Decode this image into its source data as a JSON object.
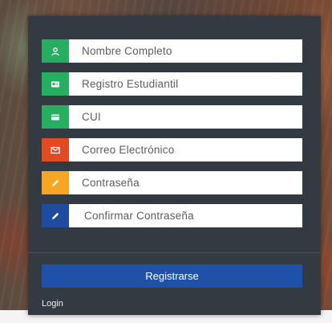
{
  "form": {
    "fields": [
      {
        "placeholder": "Nombre Completo",
        "icon": "user-icon",
        "color": "#27ae60"
      },
      {
        "placeholder": "Registro Estudiantil",
        "icon": "id-card-icon",
        "color": "#27ae60"
      },
      {
        "placeholder": "CUI",
        "icon": "card-icon",
        "color": "#27ae60"
      },
      {
        "placeholder": "Correo Electrónico",
        "icon": "envelope-icon",
        "color": "#e04b24"
      },
      {
        "placeholder": "Contraseña",
        "icon": "pencil-icon",
        "color": "#f6a623"
      },
      {
        "placeholder": "Confirmar Contraseña",
        "icon": "pencil-icon",
        "color": "#1f4c9e"
      }
    ],
    "submit_label": "Registrarse",
    "submit_color": "#2051a8",
    "login_label": "Login"
  }
}
